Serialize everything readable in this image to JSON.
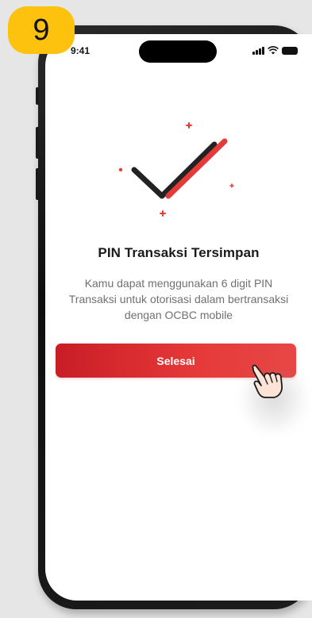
{
  "step": {
    "number": "9",
    "color": "#fcc20d"
  },
  "status_bar": {
    "time": "9:41"
  },
  "success": {
    "icon": "checkmark-icon",
    "accent_color": "#e63a3a",
    "title": "PIN Transaksi Tersimpan",
    "description_lines": [
      "Kamu dapat menggunakan 6 digit PIN",
      "Transaksi untuk otorisasi dalam bertransaksi",
      "dengan OCBC mobile"
    ]
  },
  "actions": {
    "done_label": "Selesai"
  }
}
